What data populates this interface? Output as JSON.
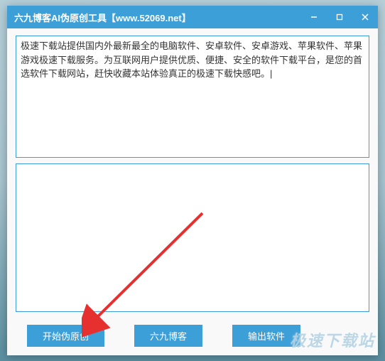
{
  "window": {
    "title": "六九博客AI伪原创工具【www.52069.net】"
  },
  "input": {
    "text": "极速下载站提供国内外最新最全的电脑软件、安卓软件、安卓游戏、苹果软件、苹果游戏极速下载服务。为互联网用户提供优质、便捷、安全的软件下载平台，是您的首选软件下载网站，赶快收藏本站体验真正的极速下载快感吧。|"
  },
  "output": {
    "text": ""
  },
  "buttons": {
    "start": "开始伪原创",
    "blog": "六九博客",
    "export": "输出软件"
  },
  "watermark": "极速下载站"
}
